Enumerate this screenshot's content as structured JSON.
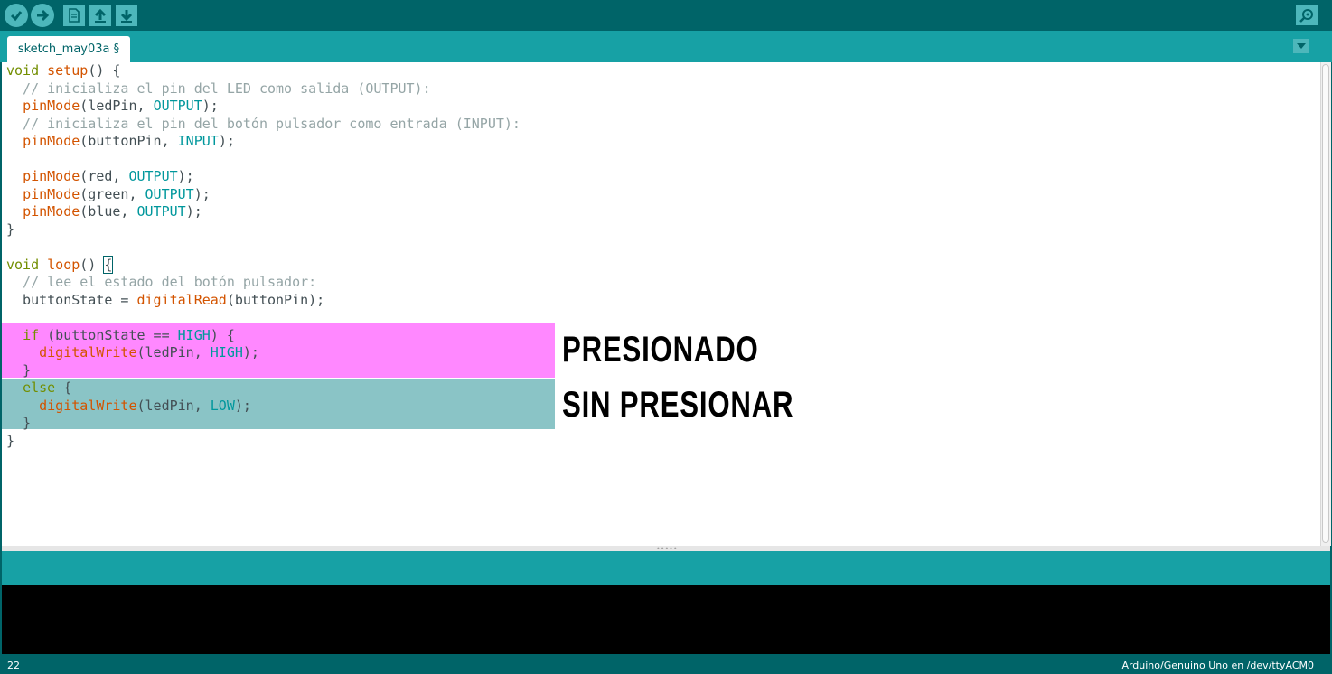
{
  "toolbar": {
    "buttons": [
      {
        "name": "verify",
        "icon": "checkmark-icon"
      },
      {
        "name": "upload",
        "icon": "arrow-right-icon"
      },
      {
        "name": "new",
        "icon": "new-file-icon"
      },
      {
        "name": "open",
        "icon": "arrow-up-icon"
      },
      {
        "name": "save",
        "icon": "arrow-down-icon"
      }
    ],
    "serial_monitor_icon": "magnifier-icon"
  },
  "tab": {
    "label": "sketch_may03a §"
  },
  "code_lines": [
    [
      {
        "t": "void",
        "c": "kw"
      },
      {
        "t": " "
      },
      {
        "t": "setup",
        "c": "fn"
      },
      {
        "t": "() {"
      }
    ],
    [
      {
        "t": "  // inicializa el pin del LED como salida (OUTPUT):",
        "c": "cm"
      }
    ],
    [
      {
        "t": "  "
      },
      {
        "t": "pinMode",
        "c": "fn"
      },
      {
        "t": "(ledPin, "
      },
      {
        "t": "OUTPUT",
        "c": "ct"
      },
      {
        "t": ");"
      }
    ],
    [
      {
        "t": "  // inicializa el pin del botón pulsador como entrada (INPUT):",
        "c": "cm"
      }
    ],
    [
      {
        "t": "  "
      },
      {
        "t": "pinMode",
        "c": "fn"
      },
      {
        "t": "(buttonPin, "
      },
      {
        "t": "INPUT",
        "c": "ct"
      },
      {
        "t": ");"
      }
    ],
    [
      {
        "t": ""
      }
    ],
    [
      {
        "t": "  "
      },
      {
        "t": "pinMode",
        "c": "fn"
      },
      {
        "t": "(red, "
      },
      {
        "t": "OUTPUT",
        "c": "ct"
      },
      {
        "t": ");"
      }
    ],
    [
      {
        "t": "  "
      },
      {
        "t": "pinMode",
        "c": "fn"
      },
      {
        "t": "(green, "
      },
      {
        "t": "OUTPUT",
        "c": "ct"
      },
      {
        "t": ");"
      }
    ],
    [
      {
        "t": "  "
      },
      {
        "t": "pinMode",
        "c": "fn"
      },
      {
        "t": "(blue, "
      },
      {
        "t": "OUTPUT",
        "c": "ct"
      },
      {
        "t": ");"
      }
    ],
    [
      {
        "t": "}"
      }
    ],
    [
      {
        "t": ""
      }
    ],
    [
      {
        "t": "void",
        "c": "kw"
      },
      {
        "t": " "
      },
      {
        "t": "loop",
        "c": "fn"
      },
      {
        "t": "() "
      },
      {
        "t": "{",
        "c": "br"
      }
    ],
    [
      {
        "t": "  // lee el estado del botón pulsador:",
        "c": "cm"
      }
    ],
    [
      {
        "t": "  buttonState = "
      },
      {
        "t": "digitalRead",
        "c": "fn"
      },
      {
        "t": "(buttonPin);"
      }
    ],
    [
      {
        "t": ""
      }
    ],
    [
      {
        "t": "  "
      },
      {
        "t": "if",
        "c": "kw"
      },
      {
        "t": " (buttonState == "
      },
      {
        "t": "HIGH",
        "c": "ct"
      },
      {
        "t": ") {"
      }
    ],
    [
      {
        "t": "    "
      },
      {
        "t": "digitalWrite",
        "c": "fn"
      },
      {
        "t": "(ledPin, "
      },
      {
        "t": "HIGH",
        "c": "ct"
      },
      {
        "t": ");"
      }
    ],
    [
      {
        "t": "  }"
      }
    ],
    [
      {
        "t": "  "
      },
      {
        "t": "else",
        "c": "kw"
      },
      {
        "t": " {"
      }
    ],
    [
      {
        "t": "    "
      },
      {
        "t": "digitalWrite",
        "c": "fn"
      },
      {
        "t": "(ledPin, "
      },
      {
        "t": "LOW",
        "c": "ct"
      },
      {
        "t": ");"
      }
    ],
    [
      {
        "t": "  }"
      }
    ],
    [
      {
        "t": "}"
      }
    ]
  ],
  "annotations": {
    "pressed": "PRESIONADO",
    "not_pressed": "SIN PRESIONAR"
  },
  "status": {
    "line_number": "22",
    "board": "Arduino/Genuino Uno en /dev/ttyACM0"
  },
  "colors": {
    "toolbar": "#006468",
    "tabbar": "#17a1a5",
    "highlight_pressed": "#ff88ff",
    "highlight_not_pressed": "#8ac4c6"
  }
}
